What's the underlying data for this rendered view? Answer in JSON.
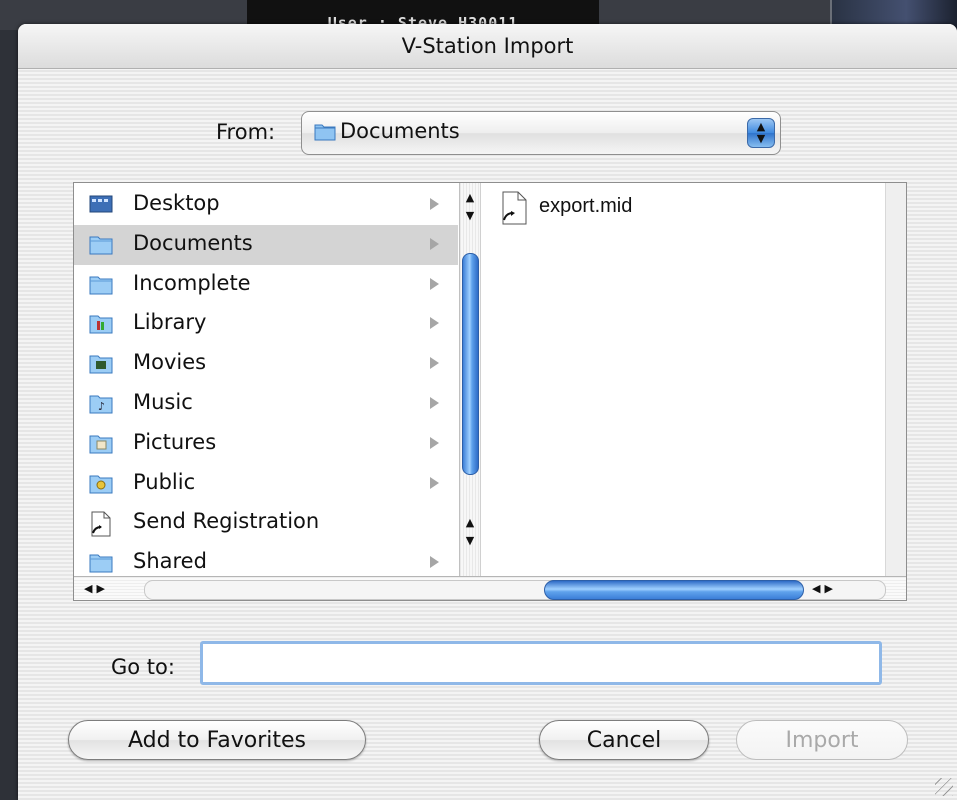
{
  "background": {
    "user_label": "User : Steve H30011"
  },
  "dialog": {
    "title": "V-Station Import",
    "from_label": "From:",
    "from_value": "Documents",
    "sidebar": [
      {
        "label": "Desktop",
        "icon": "desktop-icon",
        "has_children": true,
        "selected": false
      },
      {
        "label": "Documents",
        "icon": "folder-icon",
        "has_children": true,
        "selected": true
      },
      {
        "label": "Incomplete",
        "icon": "folder-icon",
        "has_children": true,
        "selected": false
      },
      {
        "label": "Library",
        "icon": "library-folder-icon",
        "has_children": true,
        "selected": false
      },
      {
        "label": "Movies",
        "icon": "movies-folder-icon",
        "has_children": true,
        "selected": false
      },
      {
        "label": "Music",
        "icon": "music-folder-icon",
        "has_children": true,
        "selected": false
      },
      {
        "label": "Pictures",
        "icon": "pictures-folder-icon",
        "has_children": true,
        "selected": false
      },
      {
        "label": "Public",
        "icon": "public-folder-icon",
        "has_children": true,
        "selected": false
      },
      {
        "label": "Send Registration",
        "icon": "alias-document-icon",
        "has_children": false,
        "selected": false
      },
      {
        "label": "Shared",
        "icon": "folder-icon",
        "has_children": true,
        "selected": false
      }
    ],
    "files": [
      {
        "label": "export.mid",
        "icon": "midi-file-icon"
      }
    ],
    "goto_label": "Go to:",
    "goto_value": "",
    "buttons": {
      "add_favorites": "Add to Favorites",
      "cancel": "Cancel",
      "import": "Import"
    },
    "colors": {
      "accent": "#3f8ae0",
      "selection": "#d4d4d4",
      "focus_ring": "#8fb8e8"
    }
  }
}
